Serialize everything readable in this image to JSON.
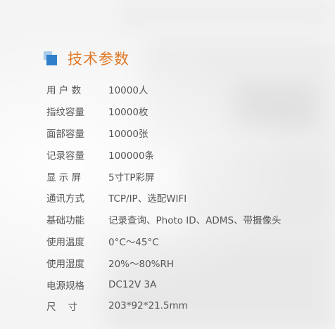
{
  "heading": {
    "title": "技术参数",
    "icon": "stacked-squares-icon"
  },
  "specs": [
    {
      "label": "用 户 数",
      "value": "10000人"
    },
    {
      "label": "指纹容量",
      "value": "10000枚"
    },
    {
      "label": "面部容量",
      "value": "10000张"
    },
    {
      "label": "记录容量",
      "value": "100000条"
    },
    {
      "label": "显 示 屏",
      "value": "5寸TP彩屏"
    },
    {
      "label": "通讯方式",
      "value": "TCP/IP、选配WIFI"
    },
    {
      "label": "基础功能",
      "value": "记录查询、Photo ID、ADMS、带摄像头"
    },
    {
      "label": "使用温度",
      "value": "0°C～45°C"
    },
    {
      "label": "使用湿度",
      "value": "20%～80%RH"
    },
    {
      "label": "电源规格",
      "value": "DC12V 3A"
    },
    {
      "label": "尺    寸",
      "value": "203*92*21.5mm"
    }
  ],
  "colors": {
    "title": "#e07a2a",
    "icon_front": "#2f7fcb",
    "icon_back": "#a9cbe9",
    "text": "#555555"
  }
}
